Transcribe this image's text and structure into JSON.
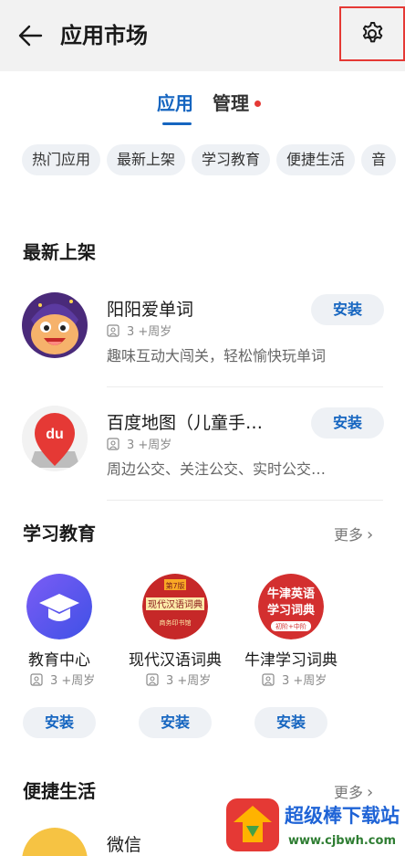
{
  "header": {
    "title": "应用市场",
    "back_icon": "arrow-left-icon",
    "settings_icon": "gear-icon",
    "highlight_color": "#e53935"
  },
  "tabs": [
    {
      "label": "应用",
      "active": true
    },
    {
      "label": "管理",
      "active": false,
      "has_dot": true
    }
  ],
  "chips": [
    "热门应用",
    "最新上架",
    "学习教育",
    "便捷生活",
    "音"
  ],
  "new_section": {
    "title": "最新上架",
    "apps": [
      {
        "name": "阳阳爱单词",
        "age": "3 +周岁",
        "desc": "趣味互动大闯关，轻松愉快玩单词",
        "button": "安装"
      },
      {
        "name": "百度地图（儿童手…",
        "age": "3 +周岁",
        "desc": "周边公交、关注公交、实时公交…",
        "button": "安装"
      }
    ]
  },
  "edu_section": {
    "title": "学习教育",
    "more": "更多",
    "apps": [
      {
        "name": "教育中心",
        "age": "3 +周岁",
        "button": "安装"
      },
      {
        "name": "现代汉语词典",
        "age": "3 +周岁",
        "button": "安装",
        "icon_text": "现代汉语词典",
        "badge": "第7版",
        "sub": "商务印书馆"
      },
      {
        "name": "牛津学习词典",
        "age": "3 +周岁",
        "button": "安装",
        "icon_text_1": "牛津英语",
        "icon_text_2": "学习词典",
        "sub": "初阶+中阶"
      }
    ]
  },
  "life_section": {
    "title": "便捷生活",
    "more": "更多",
    "apps": [
      {
        "name": "微信"
      }
    ]
  },
  "watermark": {
    "text": "超级棒下载站",
    "url": "www.cjbwh.com"
  },
  "colors": {
    "accent": "#1565c0",
    "chip_bg": "#eef1f5",
    "topbar_bg": "#f2f2f2"
  }
}
